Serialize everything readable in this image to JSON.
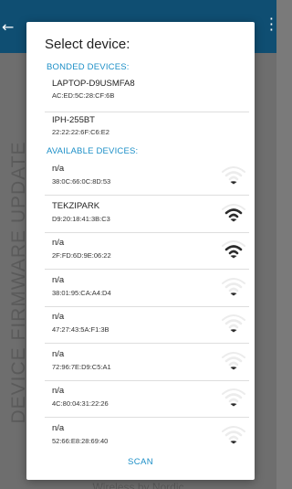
{
  "background_app": {
    "side_title": "DEVICE FIRMWARE UPDATE",
    "footer": "Wireless by Nordic",
    "icons": {
      "back": "arrow-back-icon",
      "more": "more-vert-icon"
    },
    "colors": {
      "app_bar": "#0f4e72",
      "scrim": "#6e6e6e"
    }
  },
  "dialog": {
    "title": "Select device:",
    "bonded_header": "BONDED DEVICES:",
    "available_header": "AVAILABLE DEVICES:",
    "scan_label": "SCAN",
    "accent_color": "#1c8fc7",
    "bonded_devices": [
      {
        "name": "LAPTOP-D9USMFA8",
        "address": "AC:ED:5C:28:CF:6B"
      },
      {
        "name": "IPH-255BT",
        "address": "22:22:22:6F:C6:E2"
      }
    ],
    "available_devices": [
      {
        "name": "n/a",
        "address": "38:0C:66:0C:8D:53",
        "signal_bars": 0,
        "icon": "signal-strength-icon"
      },
      {
        "name": "TEKZIPARK",
        "address": "D9:20:18:41:3B:C3",
        "signal_bars": 2,
        "icon": "signal-strength-icon"
      },
      {
        "name": "n/a",
        "address": "2F:FD:6D:9E:06:22",
        "signal_bars": 2,
        "icon": "signal-strength-icon"
      },
      {
        "name": "n/a",
        "address": "38:01:95:CA:A4:D4",
        "signal_bars": 0,
        "icon": "signal-strength-icon"
      },
      {
        "name": "n/a",
        "address": "47:27:43:5A:F1:3B",
        "signal_bars": 0,
        "icon": "signal-strength-icon"
      },
      {
        "name": "n/a",
        "address": "72:96:7E:D9:C5:A1",
        "signal_bars": 0,
        "icon": "signal-strength-icon"
      },
      {
        "name": "n/a",
        "address": "4C:80:04:31:22:26",
        "signal_bars": 0,
        "icon": "signal-strength-icon"
      },
      {
        "name": "n/a",
        "address": "52:66:E8:28:69:40",
        "signal_bars": 0,
        "icon": "signal-strength-icon"
      }
    ]
  }
}
